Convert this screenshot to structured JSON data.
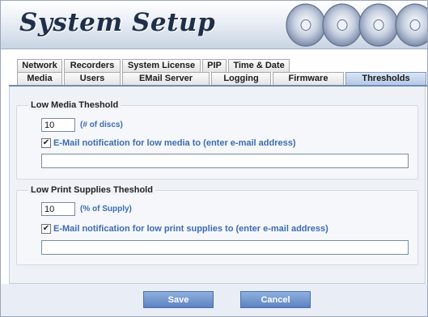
{
  "header": {
    "title": "System Setup"
  },
  "tabs": {
    "row1": [
      "Network",
      "Recorders",
      "System License",
      "PIP",
      "Time & Date"
    ],
    "row2": [
      "Media",
      "Users",
      "EMail Server",
      "Logging",
      "Firmware",
      "Thresholds"
    ],
    "active": "Thresholds"
  },
  "media": {
    "legend": "Low Media Theshold",
    "value": "10",
    "hint": "(# of discs)",
    "checked": true,
    "check_label": "E-Mail notification for low media to (enter e-mail address)",
    "email": ""
  },
  "print": {
    "legend": "Low Print Supplies Theshold",
    "value": "10",
    "hint": "(% of Supply)",
    "checked": true,
    "check_label": "E-Mail notification for low print supplies to (enter e-mail address)",
    "email": ""
  },
  "footer": {
    "save": "Save",
    "cancel": "Cancel"
  },
  "icons": {
    "checkmark": "✔"
  },
  "colors": {
    "accent": "#5d82c2",
    "label_blue": "#3c6bb3",
    "title": "#1f2f4a"
  }
}
